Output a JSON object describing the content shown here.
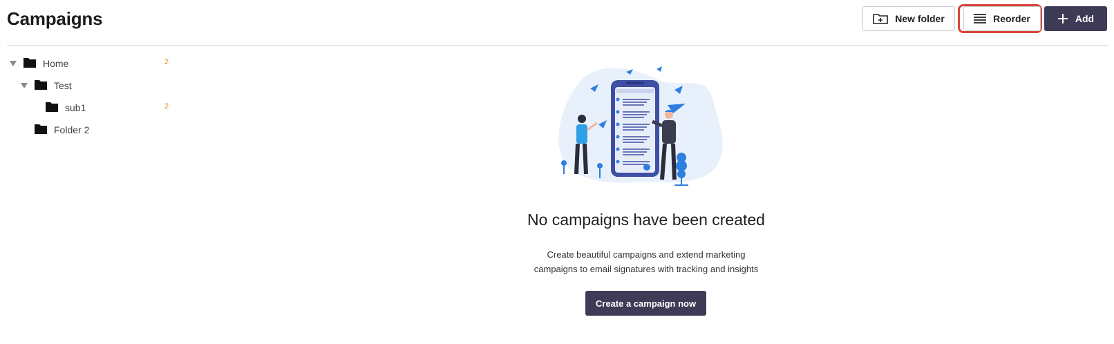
{
  "header": {
    "title": "Campaigns",
    "new_folder_label": "New folder",
    "reorder_label": "Reorder",
    "add_label": "Add"
  },
  "tree": {
    "items": [
      {
        "label": "Home",
        "count": "2",
        "expanded": true
      },
      {
        "label": "Test",
        "count": "",
        "expanded": true
      },
      {
        "label": "sub1",
        "count": "2",
        "expanded": false
      },
      {
        "label": "Folder 2",
        "count": "",
        "expanded": false
      }
    ]
  },
  "empty_state": {
    "title": "No campaigns have been created",
    "description_line1": "Create beautiful campaigns and extend marketing",
    "description_line2": "campaigns to email signatures with tracking and insights",
    "cta_label": "Create a campaign now"
  },
  "colors": {
    "primary_dark": "#3d3b55",
    "highlight": "#d9443b",
    "count_accent": "#e08a1e",
    "illustration_blue": "#2f7fe0"
  },
  "icons": {
    "new_folder": "folder-plus-icon",
    "reorder": "menu-lines-icon",
    "add": "plus-icon",
    "folder": "folder-icon",
    "caret": "caret-down-icon"
  }
}
